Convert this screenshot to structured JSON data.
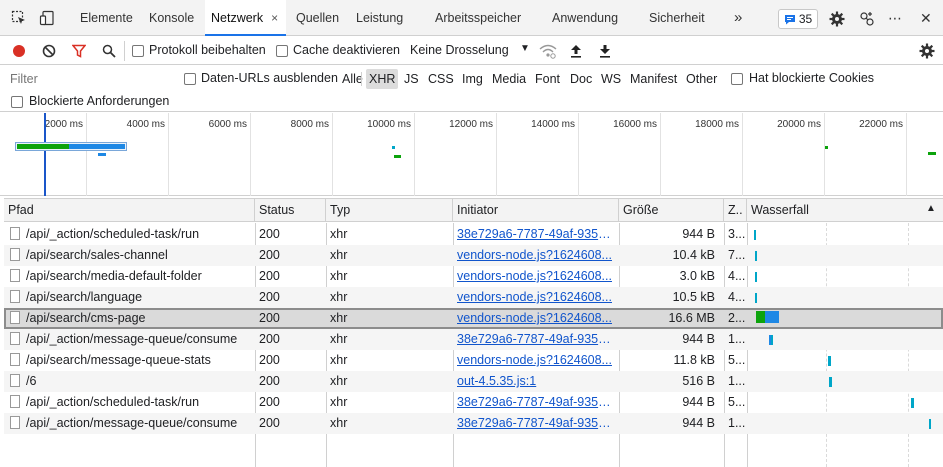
{
  "tabs": {
    "items": [
      {
        "label": "Elemente"
      },
      {
        "label": "Konsole"
      },
      {
        "label": "Netzwerk",
        "active": true
      },
      {
        "label": "Quellen"
      },
      {
        "label": "Leistung"
      },
      {
        "label": "Arbeitsspeicher"
      },
      {
        "label": "Anwendung"
      },
      {
        "label": "Sicherheit"
      }
    ],
    "more": "»",
    "close_tab": "×",
    "message_count": "35",
    "overflow": "⋯",
    "close": "✕"
  },
  "toolbar": {
    "preserve_log": "Protokoll beibehalten",
    "disable_cache": "Cache deaktivieren",
    "throttling": "Keine Drosselung"
  },
  "filter": {
    "placeholder": "Filter",
    "hide_data_urls": "Daten-URLs ausblenden",
    "types": [
      "Alle",
      "XHR",
      "JS",
      "CSS",
      "Img",
      "Media",
      "Font",
      "Doc",
      "WS",
      "Manifest",
      "Other"
    ],
    "active_type": "XHR",
    "blocked_cookies": "Hat blockierte Cookies",
    "blocked_requests": "Blockierte Anforderungen"
  },
  "overview": {
    "ticks": [
      "2000 ms",
      "4000 ms",
      "6000 ms",
      "8000 ms",
      "10000 ms",
      "12000 ms",
      "14000 ms",
      "16000 ms",
      "18000 ms",
      "20000 ms",
      "22000 ms"
    ]
  },
  "table": {
    "columns": [
      "Pfad",
      "Status",
      "Typ",
      "Initiator",
      "Größe",
      "Z..",
      "Wasserfall"
    ],
    "sort_indicator": "▲",
    "rows": [
      {
        "path": "/api/_action/scheduled-task/run",
        "status": "200",
        "type": "xhr",
        "initiator": "38e729a6-7787-49af-9357...",
        "size": "944 B",
        "time": "3..."
      },
      {
        "path": "/api/search/sales-channel",
        "status": "200",
        "type": "xhr",
        "initiator": "vendors-node.js?1624608...",
        "size": "10.4 kB",
        "time": "7..."
      },
      {
        "path": "/api/search/media-default-folder",
        "status": "200",
        "type": "xhr",
        "initiator": "vendors-node.js?1624608...",
        "size": "3.0 kB",
        "time": "4..."
      },
      {
        "path": "/api/search/language",
        "status": "200",
        "type": "xhr",
        "initiator": "vendors-node.js?1624608...",
        "size": "10.5 kB",
        "time": "4..."
      },
      {
        "path": "/api/search/cms-page",
        "status": "200",
        "type": "xhr",
        "initiator": "vendors-node.js?1624608...",
        "size": "16.6 MB",
        "time": "2...",
        "selected": true
      },
      {
        "path": "/api/_action/message-queue/consume",
        "status": "200",
        "type": "xhr",
        "initiator": "38e729a6-7787-49af-9357...",
        "size": "944 B",
        "time": "1..."
      },
      {
        "path": "/api/search/message-queue-stats",
        "status": "200",
        "type": "xhr",
        "initiator": "vendors-node.js?1624608...",
        "size": "11.8 kB",
        "time": "5..."
      },
      {
        "path": "/6",
        "status": "200",
        "type": "xhr",
        "initiator": "out-4.5.35.js:1",
        "size": "516 B",
        "time": "1..."
      },
      {
        "path": "/api/_action/scheduled-task/run",
        "status": "200",
        "type": "xhr",
        "initiator": "38e729a6-7787-49af-9357...",
        "size": "944 B",
        "time": "5..."
      },
      {
        "path": "/api/_action/message-queue/consume",
        "status": "200",
        "type": "xhr",
        "initiator": "38e729a6-7787-49af-9357...",
        "size": "944 B",
        "time": "1..."
      }
    ]
  },
  "colors": {
    "accent": "#1a73e8",
    "record": "#d93025",
    "filter_icon": "#d93025",
    "waterfall_waiting": "#0ca30c",
    "waterfall_download": "#1e88e5",
    "waterfall_cyan": "#00a6c8"
  }
}
